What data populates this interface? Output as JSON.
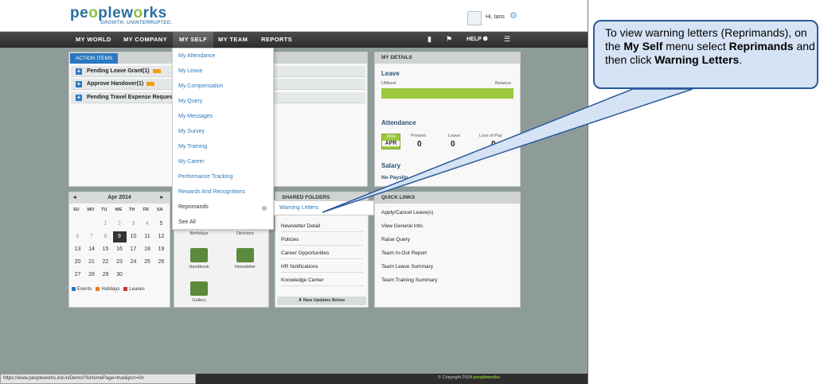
{
  "brand": {
    "logo_text_1": "pe",
    "logo_text_2": "o",
    "logo_text_3": "plew",
    "logo_text_4": "o",
    "logo_text_5": "rks",
    "tagline": "GROWTH. UNINTERRUPTED."
  },
  "user": {
    "greeting": "Hi, tans",
    "gear_icon": "⚙"
  },
  "nav": {
    "items": [
      "MY WORLD",
      "MY COMPANY",
      "MY SELF",
      "MY TEAM",
      "REPORTS"
    ],
    "active": "MY SELF",
    "help": "HELP ❷"
  },
  "action_items": {
    "tab": "ACTION ITEMS",
    "rows": [
      "Pending Leave Grant(1)",
      "Approve Handover(1)",
      "Pending Travel Expense Reques"
    ]
  },
  "dropdown": {
    "items": [
      "My Attendance",
      "My Leave",
      "My Compensation",
      "My Query",
      "My Messages",
      "My Survey",
      "My Training",
      "My Career",
      "Performance Tracking",
      "Rewards And Recognitions",
      "Reprimands",
      "See All"
    ]
  },
  "submenu": {
    "item": "Warning Letters"
  },
  "calendar": {
    "prev": "◂",
    "next": "▸",
    "month": "Apr 2014",
    "days": [
      "SU",
      "MO",
      "TU",
      "WE",
      "TH",
      "FR",
      "SA"
    ],
    "rows": [
      [
        "",
        "",
        "1",
        "2",
        "3",
        "4",
        "5"
      ],
      [
        "6",
        "7",
        "8",
        "9",
        "10",
        "11",
        "12"
      ],
      [
        "13",
        "14",
        "15",
        "16",
        "17",
        "18",
        "19"
      ],
      [
        "20",
        "21",
        "22",
        "23",
        "24",
        "25",
        "26"
      ],
      [
        "27",
        "28",
        "29",
        "30",
        "",
        "",
        ""
      ]
    ],
    "legend": [
      "Events",
      "Holidays",
      "Leaves"
    ],
    "legend_colors": [
      "#2a78bf",
      "#e67e22",
      "#c0392b"
    ]
  },
  "shortcuts": {
    "items": [
      "Birthdays",
      "Directory",
      "Handbook",
      "Newsletter",
      "Gallery"
    ]
  },
  "shared_folders": {
    "title": "SHARED FOLDERS",
    "items": [
      "Newsletter Detail",
      "Policies",
      "Career Opportunities",
      "HR Notifications",
      "Knowledge Center"
    ],
    "footer": "⬇ New Updates Below"
  },
  "my_details": {
    "title": "MY DETAILS",
    "leave": {
      "title": "Leave",
      "utilised": "Utilised",
      "balance": "Balance"
    },
    "attendance": {
      "title": "Attendance",
      "year": "2014",
      "month": "APR",
      "present_label": "Present",
      "present": "0",
      "leave_label": "Leave",
      "leave": "0",
      "lop_label": "Loss of Pay",
      "lop": "0"
    },
    "salary": {
      "title": "Salary",
      "note": "No Payslip"
    }
  },
  "quick_links": {
    "title": "QUICK LINKS",
    "items": [
      "Apply/Cancel Leave(s)",
      "View General Info.",
      "Raise Query",
      "Team In-Out Report",
      "Team Leave Summary",
      "Team Training Summary"
    ]
  },
  "status": {
    "url": "https://www.peopleworks.ind.in/Demo/?isHomePage=true&pcn=0#",
    "copyright": "© Copyright 2014",
    "copyright_brand": "peopleworks"
  },
  "callout": {
    "part1": "To view warning letters (Reprimands), on the ",
    "bold1": "My Self",
    "part2": " menu select ",
    "bold2": "Reprimands",
    "part3": " and then click ",
    "bold3": "Warning Letters",
    "part4": "."
  }
}
